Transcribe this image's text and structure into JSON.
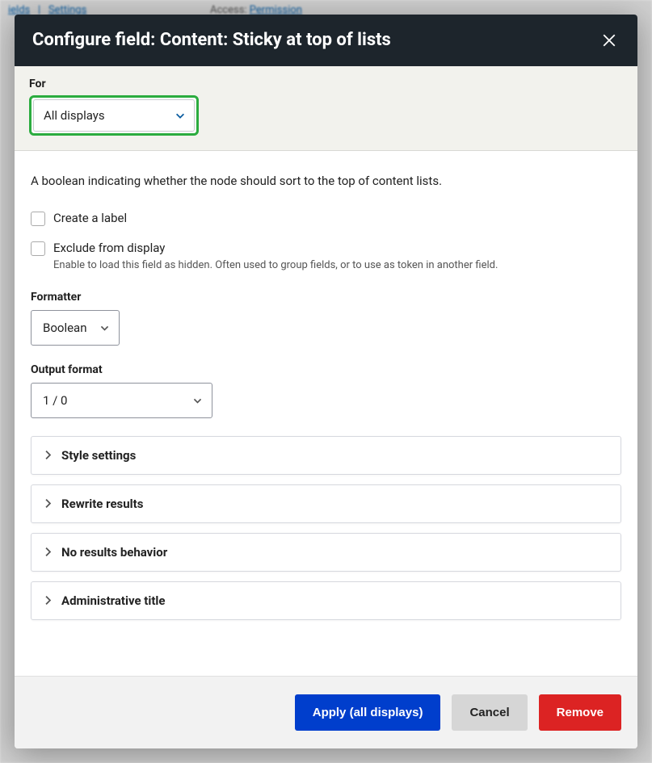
{
  "backdrop": {
    "link1": "ields",
    "sep": "|",
    "link2": "Settings",
    "access_label": "Access:",
    "access_value": "Permission"
  },
  "header": {
    "title": "Configure field: Content: Sticky at top of lists"
  },
  "for": {
    "label": "For",
    "value": "All displays"
  },
  "description": "A boolean indicating whether the node should sort to the top of content lists.",
  "checkboxes": {
    "create_label": "Create a label",
    "exclude": "Exclude from display",
    "exclude_help": "Enable to load this field as hidden. Often used to group fields, or to use as token in another field."
  },
  "formatter": {
    "label": "Formatter",
    "value": "Boolean"
  },
  "output_format": {
    "label": "Output format",
    "value": "1 / 0"
  },
  "accordions": {
    "style": "Style settings",
    "rewrite": "Rewrite results",
    "noresults": "No results behavior",
    "admin": "Administrative title"
  },
  "buttons": {
    "apply": "Apply (all displays)",
    "cancel": "Cancel",
    "remove": "Remove"
  }
}
